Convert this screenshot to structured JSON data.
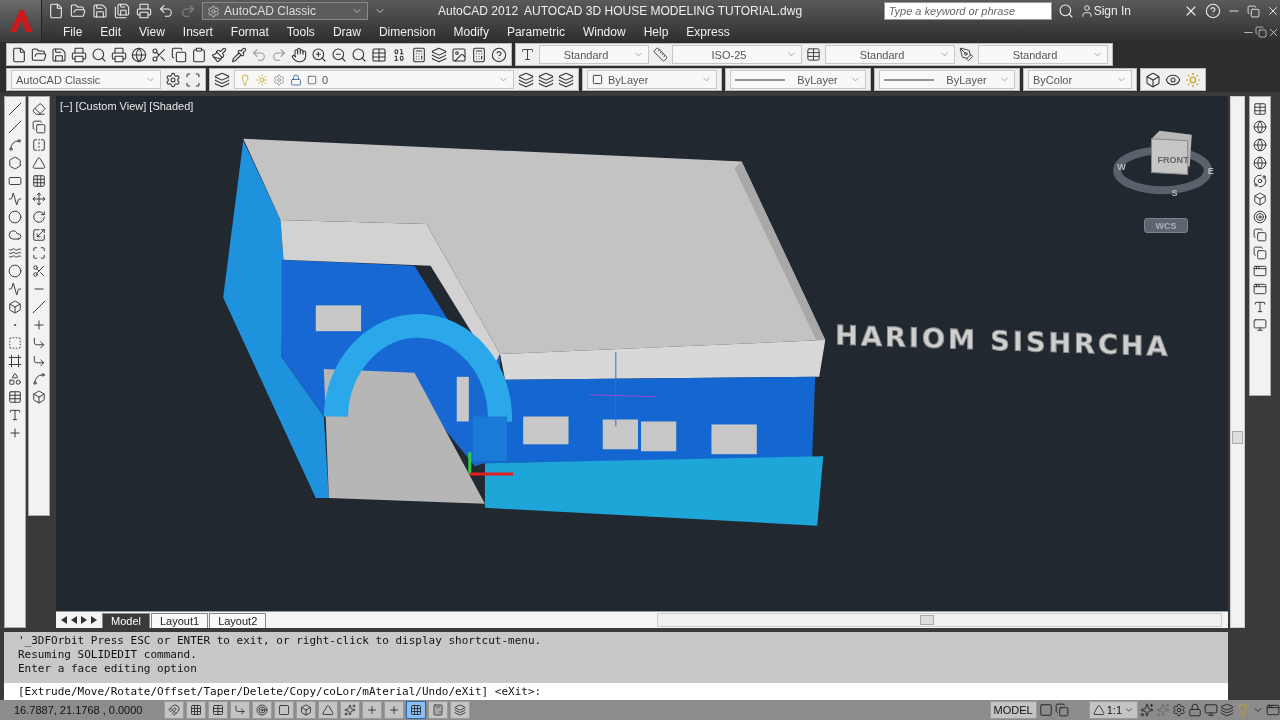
{
  "app": {
    "title": "AutoCAD 2012",
    "document": "AUTOCAD 3D HOUSE MODELING TUTORIAL.dwg",
    "workspace": "AutoCAD Classic",
    "search": {
      "placeholder": "Type a keyword or phrase"
    },
    "sign_in": "Sign In"
  },
  "menu": [
    "File",
    "Edit",
    "View",
    "Insert",
    "Format",
    "Tools",
    "Draw",
    "Dimension",
    "Modify",
    "Parametric",
    "Window",
    "Help",
    "Express"
  ],
  "styles_toolbar": [
    {
      "value": "Standard"
    },
    {
      "value": "ISO-25"
    },
    {
      "value": "Standard"
    },
    {
      "value": "Standard"
    }
  ],
  "workspace_toolbar": {
    "value": "AutoCAD Classic"
  },
  "layers_toolbar": {
    "value": "0"
  },
  "properties_toolbar": [
    {
      "kind": "color",
      "value": "ByLayer"
    },
    {
      "kind": "linetype",
      "value": "ByLayer"
    },
    {
      "kind": "lineweight",
      "value": "ByLayer"
    },
    {
      "kind": "plotstyle",
      "value": "ByColor"
    }
  ],
  "viewport": {
    "label": "[−] [Custom View] [Shaded]",
    "model_text": "HARIOM SISHRCHA",
    "viewcube": {
      "face": "FRONT",
      "compass": [
        "W",
        "S",
        "E"
      ],
      "ucs": "WCS"
    }
  },
  "layout_tabs": [
    {
      "label": "Model",
      "selected": true
    },
    {
      "label": "Layout1",
      "selected": false
    },
    {
      "label": "Layout2",
      "selected": false
    }
  ],
  "command_history": [
    "'_3DFOrbit Press ESC or ENTER to exit, or right-click to display shortcut-menu.",
    "Resuming SOLIDEDIT command.",
    "Enter a face editing option"
  ],
  "command_prompt": "[Extrude/Move/Rotate/Offset/Taper/Delete/Copy/coLor/mAterial/Undo/eXit] <eXit>:",
  "status_bar": {
    "coordinates": "16.7887, 21.1768 , 0.0000",
    "toggles": [
      {
        "on": false
      },
      {
        "on": false
      },
      {
        "on": false
      },
      {
        "on": false
      },
      {
        "on": false
      },
      {
        "on": false
      },
      {
        "on": false
      },
      {
        "on": false
      },
      {
        "on": false
      },
      {
        "on": false
      },
      {
        "on": false
      },
      {
        "on": true
      },
      {
        "on": false
      },
      {
        "on": false
      }
    ],
    "space": "MODEL",
    "scale": "1:1"
  }
}
